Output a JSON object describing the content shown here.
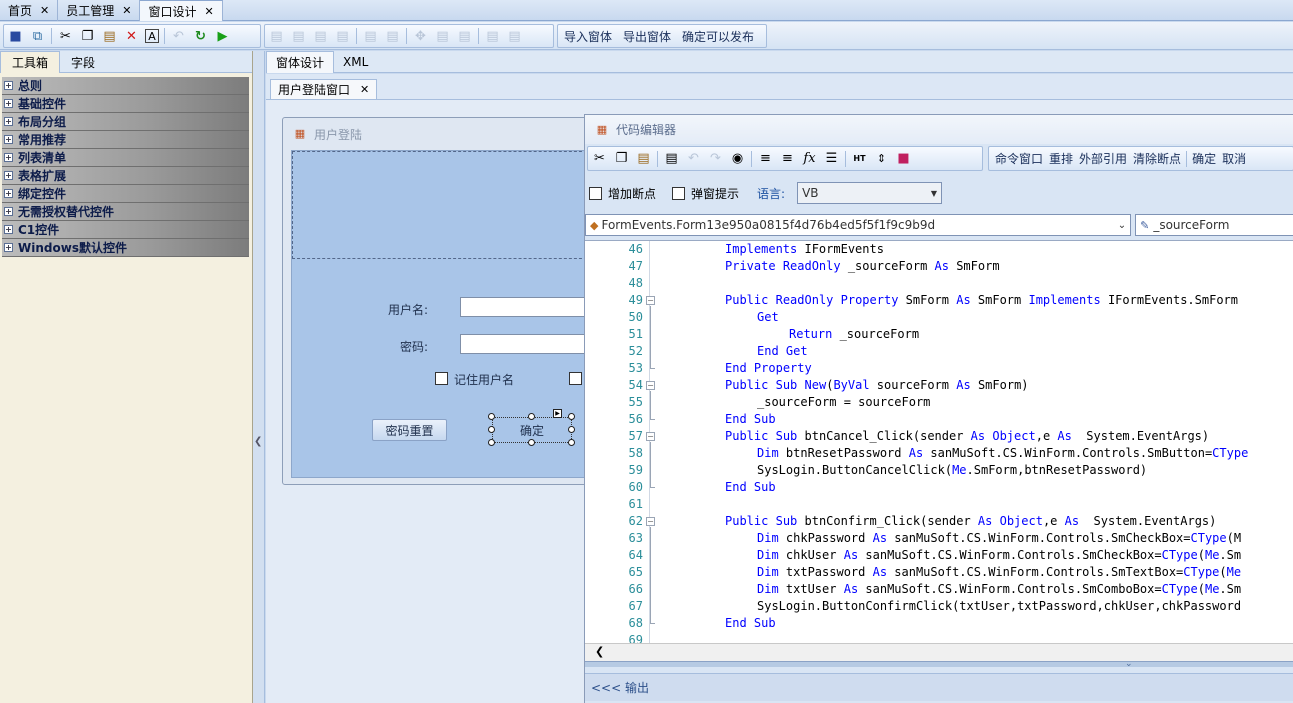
{
  "top_tabs": [
    {
      "label": "首页",
      "active": false
    },
    {
      "label": "员工管理",
      "active": false
    },
    {
      "label": "窗口设计",
      "active": true
    }
  ],
  "toolbar": {
    "icons": [
      "save-icon",
      "save-all-icon",
      "cut-icon",
      "copy-icon",
      "paste-icon",
      "delete-icon",
      "text-icon",
      "undo-icon",
      "redo-icon",
      "run-icon"
    ],
    "text_buttons": [
      "导入窗体",
      "导出窗体",
      "确定可以发布"
    ]
  },
  "left_panel": {
    "tabs": [
      "工具箱",
      "字段"
    ],
    "categories": [
      "总则",
      "基础控件",
      "布局分组",
      "常用推荐",
      "列表清单",
      "表格扩展",
      "绑定控件",
      "无需授权替代控件",
      "C1控件",
      "Windows默认控件"
    ]
  },
  "center": {
    "tabs": [
      "窗体设计",
      "XML"
    ],
    "form_tab": "用户登陆窗口"
  },
  "designed_form": {
    "title": "用户登陆",
    "username_label": "用户名:",
    "password_label": "密码:",
    "remember_label": "记住用户名",
    "reset_button": "密码重置",
    "confirm_button": "确定"
  },
  "code_editor": {
    "title": "代码编辑器",
    "right_toolbar": [
      "命令窗口",
      "重排",
      "外部引用",
      "清除断点",
      "确定",
      "取消"
    ],
    "options": {
      "breakpoint_label": "增加断点",
      "popup_label": "弹窗提示",
      "language_label": "语言:",
      "language_value": "VB"
    },
    "class_combo": "FormEvents.Form13e950a0815f4d76b4ed5f5f1f9c9b9d",
    "member_combo": "_sourceForm",
    "lines": [
      {
        "n": "46",
        "indent": 2,
        "seg": [
          {
            "k": 1,
            "t": "Implements"
          },
          {
            "k": 0,
            "t": " IFormEvents"
          }
        ]
      },
      {
        "n": "47",
        "indent": 2,
        "seg": [
          {
            "k": 1,
            "t": "Private"
          },
          {
            "k": 0,
            "t": " "
          },
          {
            "k": 1,
            "t": "ReadOnly"
          },
          {
            "k": 0,
            "t": " _sourceForm "
          },
          {
            "k": 1,
            "t": "As"
          },
          {
            "k": 0,
            "t": " SmForm"
          }
        ]
      },
      {
        "n": "48",
        "indent": 2,
        "seg": []
      },
      {
        "n": "49",
        "indent": 2,
        "seg": [
          {
            "k": 1,
            "t": "Public"
          },
          {
            "k": 0,
            "t": " "
          },
          {
            "k": 1,
            "t": "ReadOnly"
          },
          {
            "k": 0,
            "t": " "
          },
          {
            "k": 1,
            "t": "Property"
          },
          {
            "k": 0,
            "t": " SmForm "
          },
          {
            "k": 1,
            "t": "As"
          },
          {
            "k": 0,
            "t": " SmForm "
          },
          {
            "k": 1,
            "t": "Implements"
          },
          {
            "k": 0,
            "t": " IFormEvents.SmForm"
          }
        ]
      },
      {
        "n": "50",
        "indent": 3,
        "seg": [
          {
            "k": 1,
            "t": "Get"
          }
        ]
      },
      {
        "n": "51",
        "indent": 4,
        "seg": [
          {
            "k": 1,
            "t": "Return"
          },
          {
            "k": 0,
            "t": " _sourceForm"
          }
        ]
      },
      {
        "n": "52",
        "indent": 3,
        "seg": [
          {
            "k": 1,
            "t": "End"
          },
          {
            "k": 0,
            "t": " "
          },
          {
            "k": 1,
            "t": "Get"
          }
        ]
      },
      {
        "n": "53",
        "indent": 2,
        "seg": [
          {
            "k": 1,
            "t": "End"
          },
          {
            "k": 0,
            "t": " "
          },
          {
            "k": 1,
            "t": "Property"
          }
        ]
      },
      {
        "n": "54",
        "indent": 2,
        "seg": [
          {
            "k": 1,
            "t": "Public"
          },
          {
            "k": 0,
            "t": " "
          },
          {
            "k": 1,
            "t": "Sub"
          },
          {
            "k": 0,
            "t": " "
          },
          {
            "k": 1,
            "t": "New"
          },
          {
            "k": 0,
            "t": "("
          },
          {
            "k": 1,
            "t": "ByVal"
          },
          {
            "k": 0,
            "t": " sourceForm "
          },
          {
            "k": 1,
            "t": "As"
          },
          {
            "k": 0,
            "t": " SmForm)"
          }
        ]
      },
      {
        "n": "55",
        "indent": 3,
        "seg": [
          {
            "k": 0,
            "t": "_sourceForm = sourceForm"
          }
        ]
      },
      {
        "n": "56",
        "indent": 2,
        "seg": [
          {
            "k": 1,
            "t": "End"
          },
          {
            "k": 0,
            "t": " "
          },
          {
            "k": 1,
            "t": "Sub"
          }
        ]
      },
      {
        "n": "57",
        "indent": 2,
        "seg": [
          {
            "k": 1,
            "t": "Public"
          },
          {
            "k": 0,
            "t": " "
          },
          {
            "k": 1,
            "t": "Sub"
          },
          {
            "k": 0,
            "t": " btnCancel_Click(sender "
          },
          {
            "k": 1,
            "t": "As"
          },
          {
            "k": 0,
            "t": " "
          },
          {
            "k": 1,
            "t": "Object"
          },
          {
            "k": 0,
            "t": ",e "
          },
          {
            "k": 1,
            "t": "As"
          },
          {
            "k": 0,
            "t": "  System.EventArgs)"
          }
        ]
      },
      {
        "n": "58",
        "indent": 3,
        "seg": [
          {
            "k": 1,
            "t": "Dim"
          },
          {
            "k": 0,
            "t": " btnResetPassword "
          },
          {
            "k": 1,
            "t": "As"
          },
          {
            "k": 0,
            "t": " sanMuSoft.CS.WinForm.Controls.SmButton="
          },
          {
            "k": 1,
            "t": "CType"
          }
        ]
      },
      {
        "n": "59",
        "indent": 3,
        "seg": [
          {
            "k": 0,
            "t": "SysLogin.ButtonCancelClick("
          },
          {
            "k": 1,
            "t": "Me"
          },
          {
            "k": 0,
            "t": ".SmForm,btnResetPassword)"
          }
        ]
      },
      {
        "n": "60",
        "indent": 2,
        "seg": [
          {
            "k": 1,
            "t": "End"
          },
          {
            "k": 0,
            "t": " "
          },
          {
            "k": 1,
            "t": "Sub"
          }
        ]
      },
      {
        "n": "61",
        "indent": 2,
        "seg": []
      },
      {
        "n": "62",
        "indent": 2,
        "seg": [
          {
            "k": 1,
            "t": "Public"
          },
          {
            "k": 0,
            "t": " "
          },
          {
            "k": 1,
            "t": "Sub"
          },
          {
            "k": 0,
            "t": " btnConfirm_Click(sender "
          },
          {
            "k": 1,
            "t": "As"
          },
          {
            "k": 0,
            "t": " "
          },
          {
            "k": 1,
            "t": "Object"
          },
          {
            "k": 0,
            "t": ",e "
          },
          {
            "k": 1,
            "t": "As"
          },
          {
            "k": 0,
            "t": "  System.EventArgs)"
          }
        ]
      },
      {
        "n": "63",
        "indent": 3,
        "seg": [
          {
            "k": 1,
            "t": "Dim"
          },
          {
            "k": 0,
            "t": " chkPassword "
          },
          {
            "k": 1,
            "t": "As"
          },
          {
            "k": 0,
            "t": " sanMuSoft.CS.WinForm.Controls.SmCheckBox="
          },
          {
            "k": 1,
            "t": "CType"
          },
          {
            "k": 0,
            "t": "(M"
          }
        ]
      },
      {
        "n": "64",
        "indent": 3,
        "seg": [
          {
            "k": 1,
            "t": "Dim"
          },
          {
            "k": 0,
            "t": " chkUser "
          },
          {
            "k": 1,
            "t": "As"
          },
          {
            "k": 0,
            "t": " sanMuSoft.CS.WinForm.Controls.SmCheckBox="
          },
          {
            "k": 1,
            "t": "CType"
          },
          {
            "k": 0,
            "t": "("
          },
          {
            "k": 1,
            "t": "Me"
          },
          {
            "k": 0,
            "t": ".Sm"
          }
        ]
      },
      {
        "n": "65",
        "indent": 3,
        "seg": [
          {
            "k": 1,
            "t": "Dim"
          },
          {
            "k": 0,
            "t": " txtPassword "
          },
          {
            "k": 1,
            "t": "As"
          },
          {
            "k": 0,
            "t": " sanMuSoft.CS.WinForm.Controls.SmTextBox="
          },
          {
            "k": 1,
            "t": "CType"
          },
          {
            "k": 0,
            "t": "("
          },
          {
            "k": 1,
            "t": "Me"
          }
        ]
      },
      {
        "n": "66",
        "indent": 3,
        "seg": [
          {
            "k": 1,
            "t": "Dim"
          },
          {
            "k": 0,
            "t": " txtUser "
          },
          {
            "k": 1,
            "t": "As"
          },
          {
            "k": 0,
            "t": " sanMuSoft.CS.WinForm.Controls.SmComboBox="
          },
          {
            "k": 1,
            "t": "CType"
          },
          {
            "k": 0,
            "t": "("
          },
          {
            "k": 1,
            "t": "Me"
          },
          {
            "k": 0,
            "t": ".Sm"
          }
        ]
      },
      {
        "n": "67",
        "indent": 3,
        "seg": [
          {
            "k": 0,
            "t": "SysLogin.ButtonConfirmClick(txtUser,txtPassword,chkUser,chkPassword"
          }
        ]
      },
      {
        "n": "68",
        "indent": 2,
        "seg": [
          {
            "k": 1,
            "t": "End"
          },
          {
            "k": 0,
            "t": " "
          },
          {
            "k": 1,
            "t": "Sub"
          }
        ]
      },
      {
        "n": "69",
        "indent": 2,
        "seg": []
      }
    ],
    "folds": [
      "49",
      "54",
      "57",
      "62"
    ],
    "output_label": "<<< 输出"
  },
  "colors": {
    "keyword": "#0000ff",
    "line_number": "#2b8e9a",
    "accent": "#1a2f5a"
  }
}
